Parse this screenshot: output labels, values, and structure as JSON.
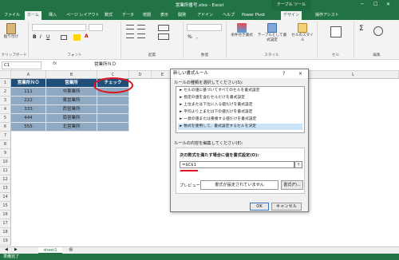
{
  "window": {
    "title": "営業所番号.xlsx - Excel",
    "table_tools": "テーブル ツール"
  },
  "tabs": [
    "ファイル",
    "ホーム",
    "挿入",
    "ページ レイアウト",
    "数式",
    "データ",
    "校閲",
    "表示",
    "開発",
    "アドイン",
    "ヘルプ",
    "Power Pivot",
    "デザイン"
  ],
  "design_tab": "デザイン",
  "search_hint": "操作アシスト",
  "ribbon": {
    "paste": "貼り付け",
    "clipboard": "クリップボード",
    "font": "フォント",
    "alignment": "配置",
    "number": "数値",
    "conditional": "条件付き書式",
    "format_table": "テーブルとして書式設定",
    "cell_styles": "セルのスタイル",
    "styles": "スタイル",
    "cells": "セル",
    "editing": "編集"
  },
  "formula_bar": {
    "name_box": "C1",
    "fx": "fx",
    "value": "営業所ＮＯ"
  },
  "columns": [
    "A",
    "B",
    "C",
    "D",
    "E",
    "F",
    "G",
    "H",
    "I",
    "J",
    "K",
    "L"
  ],
  "rows": [
    "1",
    "2",
    "3",
    "4",
    "5",
    "6",
    "7",
    "8",
    "9",
    "10",
    "11",
    "12",
    "13",
    "14",
    "15",
    "16",
    "17",
    "18",
    "19"
  ],
  "table": {
    "headers": [
      "営業所ＮＯ",
      "営業所",
      "チェック"
    ],
    "rows": [
      [
        "111",
        "中東業所",
        ""
      ],
      [
        "222",
        "東営業所",
        ""
      ],
      [
        "333",
        "西営業所",
        ""
      ],
      [
        "444",
        "南営業所",
        ""
      ],
      [
        "555",
        "北営業所",
        ""
      ]
    ]
  },
  "dialog": {
    "title": "新しい書式ルール",
    "help": "?",
    "close": "×",
    "select_type_label": "ルールの種類を選択してください(S):",
    "rule_types": [
      "► セルの値に基づいてすべてのセルを書式設定",
      "► 指定の値を含むセルだけを書式設定",
      "► 上位または下位に入る値だけを書式設定",
      "► 平均より上または下の値だけを書式設定",
      "► 一意の値または重複する値だけを書式設定",
      "► 数式を使用して、書式設定するセルを決定"
    ],
    "edit_label": "ルールの内容を編集してください(E):",
    "formula_label": "次の数式を満たす場合に値を書式設定(O):",
    "formula": "=$C$1",
    "preview_label": "プレビュー:",
    "preview_text": "書式が設定されていません",
    "format_button": "書式(F)...",
    "ok": "OK",
    "cancel": "キャンセル"
  },
  "sheet_tab": "sheet1",
  "status": "準備完了"
}
